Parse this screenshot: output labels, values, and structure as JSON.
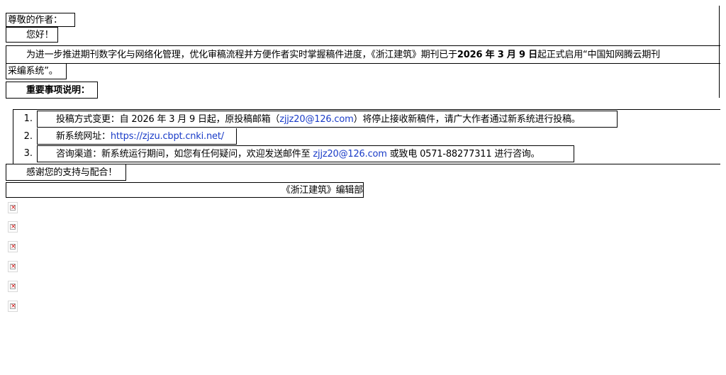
{
  "letter": {
    "salutation": "尊敬的作者：",
    "greeting": "您好！",
    "intro_part1": "为进一步推进期刊数字化与网络化管理，优化审稿流程并方便作者实时掌握稿件进度，《浙江建筑》期刊已于",
    "intro_bold": "2026 年 3 月 9 日",
    "intro_part2": "起正式启用“中国知网腾云期刊",
    "intro_line2": "采编系统”。",
    "section_title": "重要事项说明：",
    "items": [
      {
        "number": "1.",
        "text_before": "投稿方式变更：自 2026 年 3 月 9 日起，原投稿邮箱（",
        "email": "zjjz20@126.com",
        "text_after": "）将停止接收新稿件，请广大作者通过新系统进行投稿。"
      },
      {
        "number": "2.",
        "text_before": "新系统网址：",
        "link": "https://zjzu.cbpt.cnki.net/"
      },
      {
        "number": "3.",
        "text_before": "咨询渠道：新系统运行期间，如您有任何疑问，欢迎发送邮件至",
        "email": "zjjz20@126.com",
        "text_after": "或致电 0571-88277311 进行咨询。"
      }
    ],
    "thanks": "感谢您的支持与配合！",
    "signature": "《浙江建筑》编辑部"
  },
  "broken_images": [
    "broken-image-icon",
    "broken-image-icon",
    "broken-image-icon",
    "broken-image-icon",
    "broken-image-icon",
    "broken-image-icon"
  ]
}
